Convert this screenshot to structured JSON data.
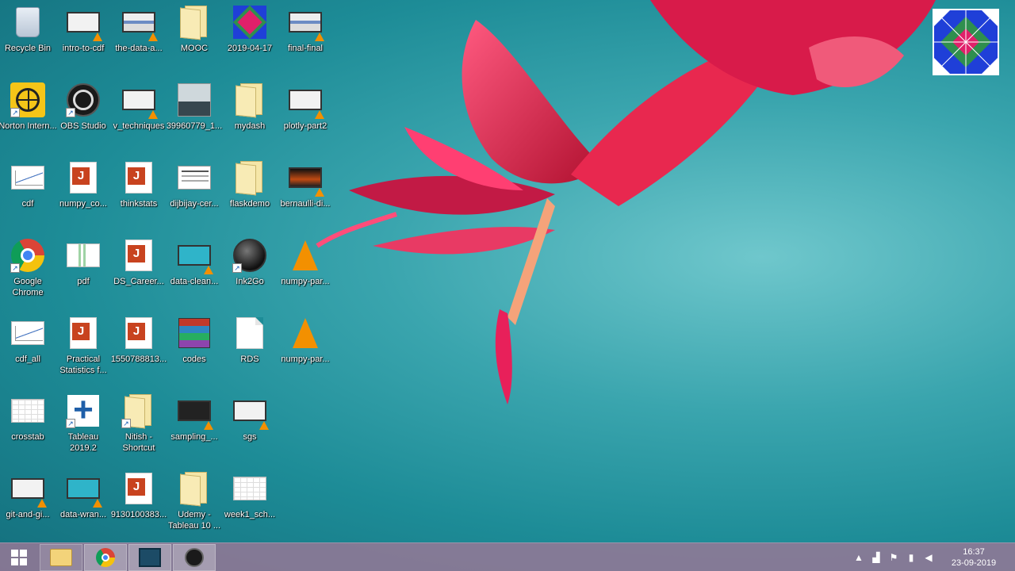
{
  "desktop": {
    "icons": {
      "recycle_bin": "Recycle Bin",
      "intro_to_cdf": "intro-to-cdf",
      "the_data_a": "the-data-a...",
      "mooc": "MOOC",
      "date_folder": "2019-04-17",
      "final_final": "final-final",
      "norton": "Norton Intern...",
      "obs": "OBS Studio",
      "v_techniques": "v_techniques",
      "photo_39960779": "39960779_1...",
      "mydash": "mydash",
      "plotly_part2": "plotly-part2",
      "cdf": "cdf",
      "numpy_co": "numpy_co...",
      "thinkstats": "thinkstats",
      "dijbijay_cer": "dijbijay-cer...",
      "flaskdemo": "flaskdemo",
      "bernaulli_di": "bernaulli-di...",
      "google_chrome": "Google Chrome",
      "pdf": "pdf",
      "ds_career": "DS_Career...",
      "data_clean": "data-clean...",
      "ink2go": "Ink2Go",
      "numpy_par_1": "numpy-par...",
      "cdf_all": "cdf_all",
      "practical_stats": "Practical Statistics f...",
      "num_1550788813": "1550788813...",
      "codes": "codes",
      "rds": "RDS",
      "numpy_par_2": "numpy-par...",
      "crosstab": "crosstab",
      "tableau": "Tableau 2019.2",
      "nitish_shortcut": "Nitish - Shortcut",
      "sampling": "sampling_...",
      "sgs": "sgs",
      "git_and_gi": "git-and-gi...",
      "data_wran": "data-wran...",
      "num_9130100383": "9130100383...",
      "udemy_tableau": "Udemy - Tableau 10 ...",
      "week1_sch": "week1_sch..."
    }
  },
  "taskbar": {
    "clock_time": "16:37",
    "clock_date": "23-09-2019"
  },
  "colors": {
    "wallpaper_teal": "#1d8c97",
    "flower_red": "#d81b4a",
    "taskbar": "#967896"
  }
}
